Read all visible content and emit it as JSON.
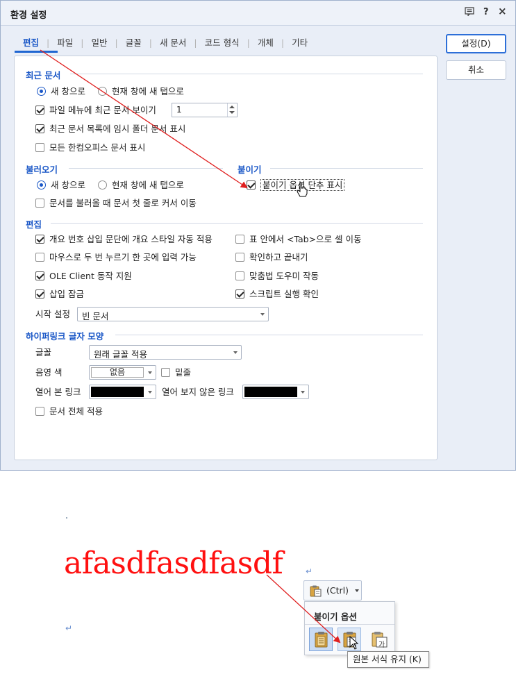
{
  "window": {
    "title": "환경 설정",
    "buttons": {
      "help_q": "?",
      "close": "×"
    }
  },
  "tabs": [
    {
      "label": "편집",
      "active": true
    },
    {
      "label": "파일",
      "active": false
    },
    {
      "label": "일반",
      "active": false
    },
    {
      "label": "글꼴",
      "active": false
    },
    {
      "label": "새 문서",
      "active": false
    },
    {
      "label": "코드 형식",
      "active": false
    },
    {
      "label": "개체",
      "active": false
    },
    {
      "label": "기타",
      "active": false
    }
  ],
  "actions": {
    "ok": "설정(D)",
    "cancel": "취소"
  },
  "recent": {
    "header": "최근 문서",
    "radio_new_window": "새 창으로",
    "radio_new_tab": "현재 창에 새 탭으로",
    "show_in_file_menu": "파일 메뉴에 최근 문서 보이기",
    "count": "1",
    "show_temp_folder": "최근 문서 목록에 임시 폴더 문서 표시",
    "show_all_hancom": "모든 한컴오피스 문서 표시"
  },
  "open": {
    "header": "불러오기",
    "radio_new_window": "새 창으로",
    "radio_new_tab": "현재 창에 새 탭으로",
    "move_cursor": "문서를 불러올 때 문서 첫 줄로 커서 이동"
  },
  "paste": {
    "header": "붙이기",
    "show_options": "붙이기 옵션 단추 표시"
  },
  "edit": {
    "header": "편집",
    "auto_outline": "개요 번호 삽입 문단에 개요 스타일 자동 적용",
    "tab_in_table": "표 안에서 <Tab>으로 셀 이동",
    "double_click_input": "마우스로 두 번 누르기 한 곳에 입력 가능",
    "confirm_exit": "확인하고 끝내기",
    "ole_client": "OLE Client 동작 지원",
    "spell_helper": "맞춤법 도우미 작동",
    "insert_lock": "삽입 잠금",
    "script_confirm": "스크립트 실행 확인",
    "start_label": "시작 설정",
    "start_value": "빈 문서"
  },
  "hyperlink": {
    "header": "하이퍼링크 글자 모양",
    "font_label": "글꼴",
    "font_value": "원래 글꼴 적용",
    "shade_label": "음영 색",
    "shade_value": "없음",
    "underline": "밑줄",
    "visited_label": "열어 본 링크",
    "unvisited_label": "열어 보지 않은 링크",
    "apply_all": "문서 전체 적용"
  },
  "document": {
    "text": "afasdfasdfasdf",
    "paragraph_mark": "↵"
  },
  "paste_button": {
    "label": "(Ctrl)"
  },
  "paste_popup": {
    "title": "붙이기 옵션",
    "tooltip": "원본 서식 유지 (K)",
    "option_glyph": "가"
  },
  "colors": {
    "accent": "#1a57c7",
    "document_text": "#ff1010",
    "arrow": "#e02020",
    "link_color": "#000000"
  }
}
